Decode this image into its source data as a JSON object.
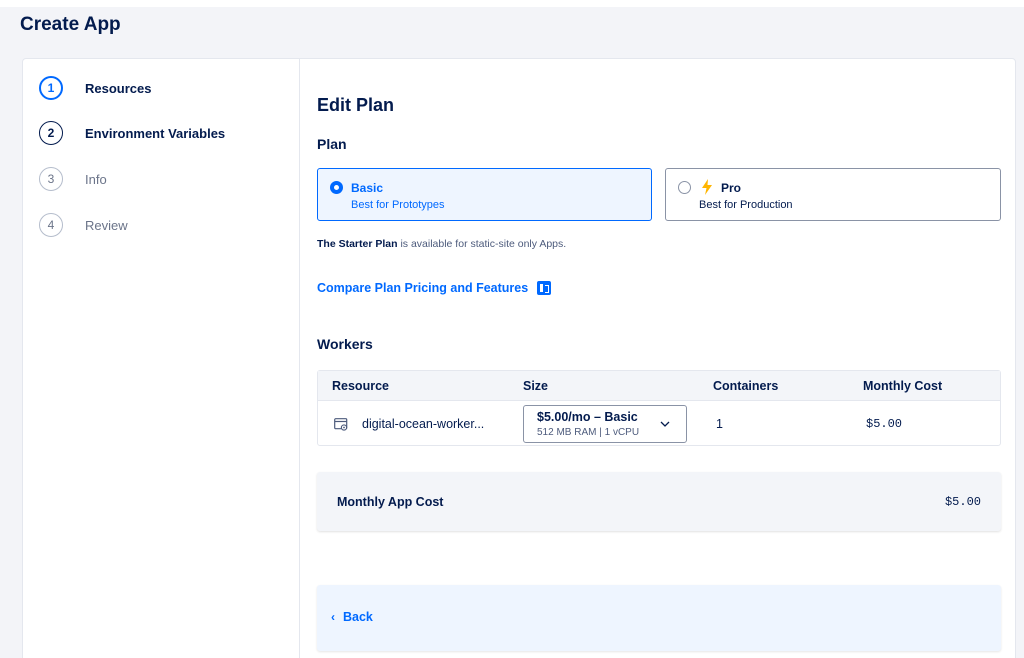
{
  "page": {
    "title": "Create App"
  },
  "steps": [
    {
      "num": "1",
      "label": "Resources",
      "state": "active"
    },
    {
      "num": "2",
      "label": "Environment Variables",
      "state": "done"
    },
    {
      "num": "3",
      "label": "Info",
      "state": "todo"
    },
    {
      "num": "4",
      "label": "Review",
      "state": "todo"
    }
  ],
  "main": {
    "title": "Edit Plan",
    "plan_label": "Plan",
    "plans": [
      {
        "name": "Basic",
        "desc": "Best for Prototypes",
        "selected": true
      },
      {
        "name": "Pro",
        "desc": "Best for Production",
        "selected": false,
        "icon": "bolt-icon"
      }
    ],
    "starter_note_bold": "The Starter Plan",
    "starter_note_rest": " is available for static-site only Apps.",
    "compare_link": "Compare Plan Pricing and Features",
    "workers_label": "Workers",
    "table": {
      "headers": [
        "Resource",
        "Size",
        "Containers",
        "Monthly Cost"
      ],
      "rows": [
        {
          "resource": "digital-ocean-worker...",
          "size_main": "$5.00/mo – Basic",
          "size_sub": "512 MB RAM | 1 vCPU",
          "containers": "1",
          "monthly_cost": "$5.00"
        }
      ]
    },
    "monthly_app_cost_label": "Monthly App Cost",
    "monthly_app_cost_value": "$5.00",
    "back_label": "Back"
  },
  "colors": {
    "accent": "#0069ff",
    "text": "#031b4e",
    "muted": "#6b7489",
    "selected_bg": "#eef5ff",
    "bolt": "#ffb500"
  }
}
